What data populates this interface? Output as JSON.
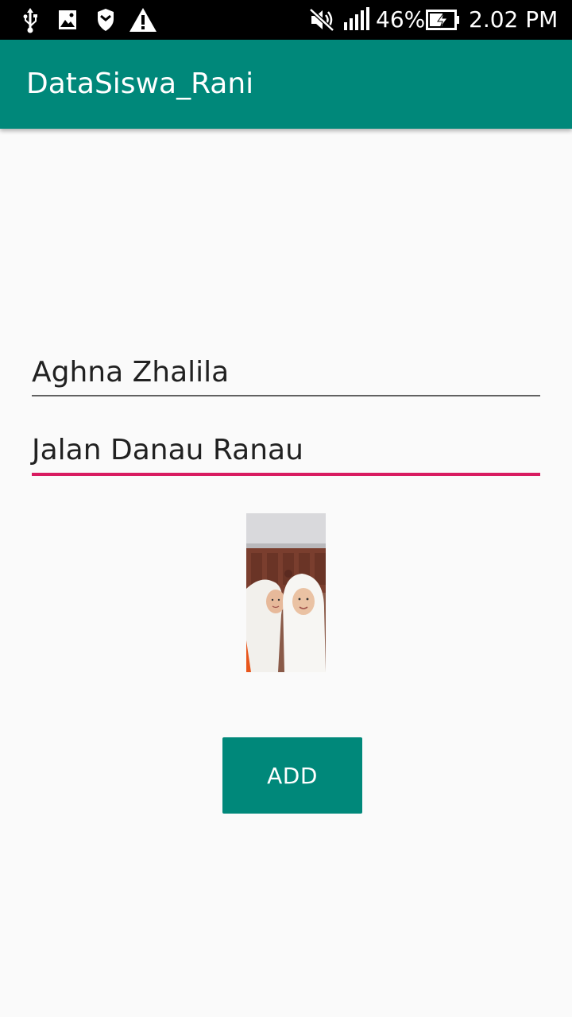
{
  "status_bar": {
    "battery_percent": "46%",
    "time": "2.02 PM",
    "icons": [
      "usb-icon",
      "image-icon",
      "shield-icon",
      "warning-icon",
      "mute-icon",
      "signal-icon",
      "battery-charging-icon"
    ]
  },
  "app_bar": {
    "title": "DataSiswa_Rani",
    "color": "#00887a"
  },
  "form": {
    "name_value": "Aghna Zhalila",
    "address_value": "Jalan Danau Ranau",
    "focus_color": "#d81b60",
    "add_label": "ADD"
  }
}
